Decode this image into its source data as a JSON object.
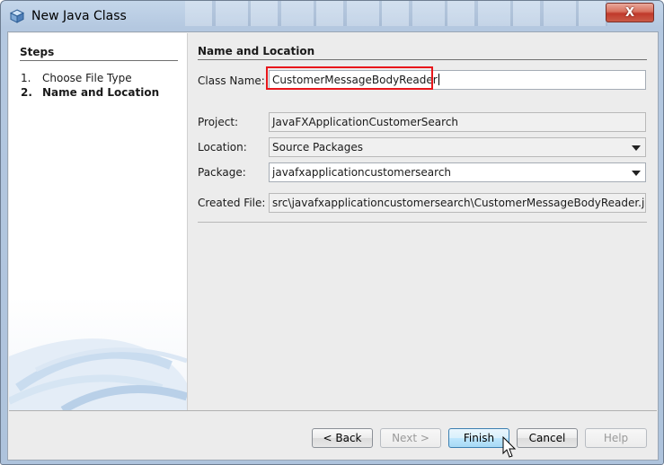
{
  "window": {
    "title": "New Java Class",
    "close_glyph": "X"
  },
  "steps": {
    "title": "Steps",
    "items": [
      {
        "number": "1.",
        "label": "Choose File Type",
        "current": false
      },
      {
        "number": "2.",
        "label": "Name and Location",
        "current": true
      }
    ]
  },
  "form": {
    "section_title": "Name and Location",
    "class_name_label": "Class Name:",
    "class_name_value": "CustomerMessageBodyReader",
    "project_label": "Project:",
    "project_value": "JavaFXApplicationCustomerSearch",
    "location_label": "Location:",
    "location_value": "Source Packages",
    "package_label": "Package:",
    "package_value": "javafxapplicationcustomersearch",
    "created_file_label": "Created File:",
    "created_file_value": "src\\javafxapplicationcustomersearch\\CustomerMessageBodyReader.java"
  },
  "buttons": {
    "back": "< Back",
    "next": "Next >",
    "finish": "Finish",
    "cancel": "Cancel",
    "help": "Help"
  },
  "colors": {
    "highlight_border": "#e8161b",
    "default_button": "#bee6fd"
  }
}
